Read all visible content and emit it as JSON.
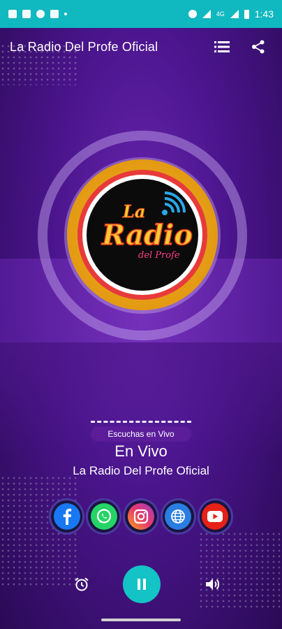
{
  "status_bar": {
    "time": "1:43",
    "network": "4G"
  },
  "appbar": {
    "title": "La Radio Del Profe Oficial",
    "menu_icon": "list-icon",
    "share_icon": "share-icon"
  },
  "logo": {
    "line1": "La",
    "line2": "Radio",
    "line3": "del Profe"
  },
  "live": {
    "listeners_label": "Escuchas en Vivo",
    "status": "En Vivo",
    "station": "La Radio Del Profe Oficial"
  },
  "social": [
    {
      "name": "facebook",
      "icon": "facebook-icon",
      "color": "#1877f2"
    },
    {
      "name": "whatsapp",
      "icon": "whatsapp-icon",
      "color": "#25d366"
    },
    {
      "name": "instagram",
      "icon": "instagram-icon",
      "color": "#d6249f"
    },
    {
      "name": "website",
      "icon": "globe-icon",
      "color": "#2a7de1"
    },
    {
      "name": "youtube",
      "icon": "youtube-icon",
      "color": "#e62117"
    }
  ],
  "controls": {
    "alarm_icon": "alarm-icon",
    "play_icon": "pause-icon",
    "volume_icon": "volume-icon"
  },
  "colors": {
    "status_bar": "#10b8c0",
    "accent": "#14c3c6",
    "background": "#4a158c"
  }
}
